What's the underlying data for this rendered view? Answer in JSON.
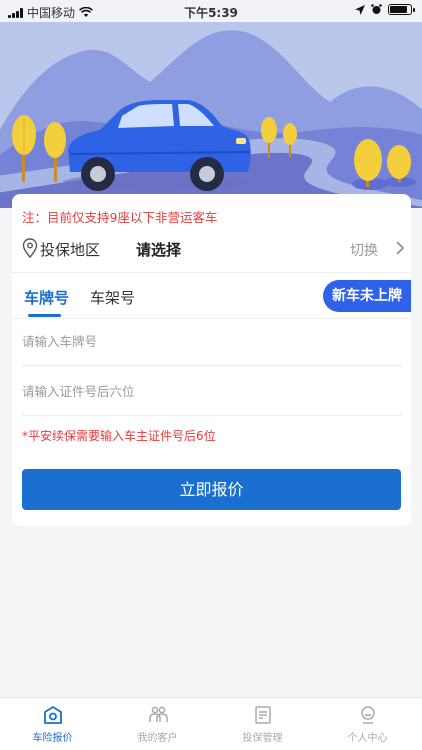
{
  "status_bar": {
    "carrier": "中国移动",
    "time": "下午5:39",
    "battery_level": 0.85
  },
  "form": {
    "notice": "注：目前仅支持9座以下非营运客车",
    "region_label": "投保地区",
    "region_value": "请选择",
    "switch_label": "切换",
    "tabs": [
      "车牌号",
      "车架号"
    ],
    "active_tab": 0,
    "new_car_label": "新车未上牌",
    "plate_placeholder": "请输入车牌号",
    "id_placeholder": "请输入证件号后六位",
    "hint": "*平安续保需要输入车主证件号后6位",
    "submit_label": "立即报价"
  },
  "nav": {
    "items": [
      {
        "label": "车险报价",
        "icon": "home-camera-icon",
        "active": true
      },
      {
        "label": "我的客户",
        "icon": "customers-icon",
        "active": false
      },
      {
        "label": "投保管理",
        "icon": "document-icon",
        "active": false
      },
      {
        "label": "个人中心",
        "icon": "profile-icon",
        "active": false
      }
    ]
  },
  "colors": {
    "accent": "#1a6fd0",
    "new_car_button": "#2f62e8",
    "warning": "#e83b3b",
    "hero_sky": "#b7c6ec",
    "car_body": "#2e63e6"
  }
}
